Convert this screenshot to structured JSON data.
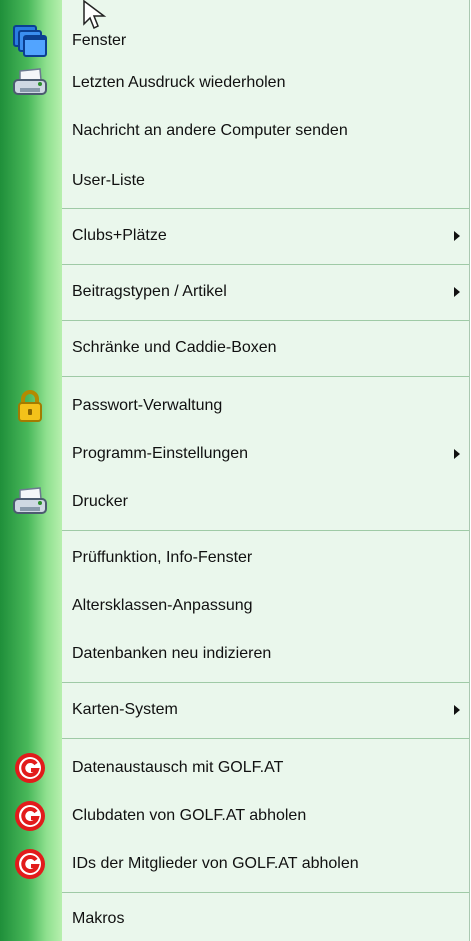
{
  "menu": {
    "items": [
      {
        "label": "Fenster",
        "icon": "windows-icon",
        "has_submenu": false
      },
      {
        "label": "Letzten Ausdruck wiederholen",
        "icon": "printer-icon",
        "has_submenu": false
      },
      {
        "label": "Nachricht an andere Computer senden",
        "icon": null,
        "has_submenu": false
      },
      {
        "label": "User-Liste",
        "icon": null,
        "has_submenu": false
      },
      {
        "label": "Clubs+Plätze",
        "icon": null,
        "has_submenu": true
      },
      {
        "label": "Beitragstypen / Artikel",
        "icon": null,
        "has_submenu": true
      },
      {
        "label": "Schränke und Caddie-Boxen",
        "icon": null,
        "has_submenu": false
      },
      {
        "label": "Passwort-Verwaltung",
        "icon": "padlock-icon",
        "has_submenu": false
      },
      {
        "label": "Programm-Einstellungen",
        "icon": null,
        "has_submenu": true
      },
      {
        "label": "Drucker",
        "icon": "printer-icon",
        "has_submenu": false
      },
      {
        "label": "Prüffunktion, Info-Fenster",
        "icon": null,
        "has_submenu": false
      },
      {
        "label": "Altersklassen-Anpassung",
        "icon": null,
        "has_submenu": false
      },
      {
        "label": "Datenbanken neu indizieren",
        "icon": null,
        "has_submenu": false
      },
      {
        "label": "Karten-System",
        "icon": null,
        "has_submenu": true
      },
      {
        "label": "Datenaustausch mit GOLF.AT",
        "icon": "golf-at-icon",
        "has_submenu": false
      },
      {
        "label": "Clubdaten von GOLF.AT abholen",
        "icon": "golf-at-icon",
        "has_submenu": false
      },
      {
        "label": "IDs der Mitglieder von GOLF.AT abholen",
        "icon": "golf-at-icon",
        "has_submenu": false
      },
      {
        "label": "Makros",
        "icon": null,
        "has_submenu": false
      }
    ]
  },
  "colors": {
    "menu_background": "#eaf7ec",
    "gutter_dark": "#1f8f3a",
    "gutter_light": "#b7efae",
    "separator": "#9fcaa6",
    "golf_at_red": "#e21b1b"
  }
}
